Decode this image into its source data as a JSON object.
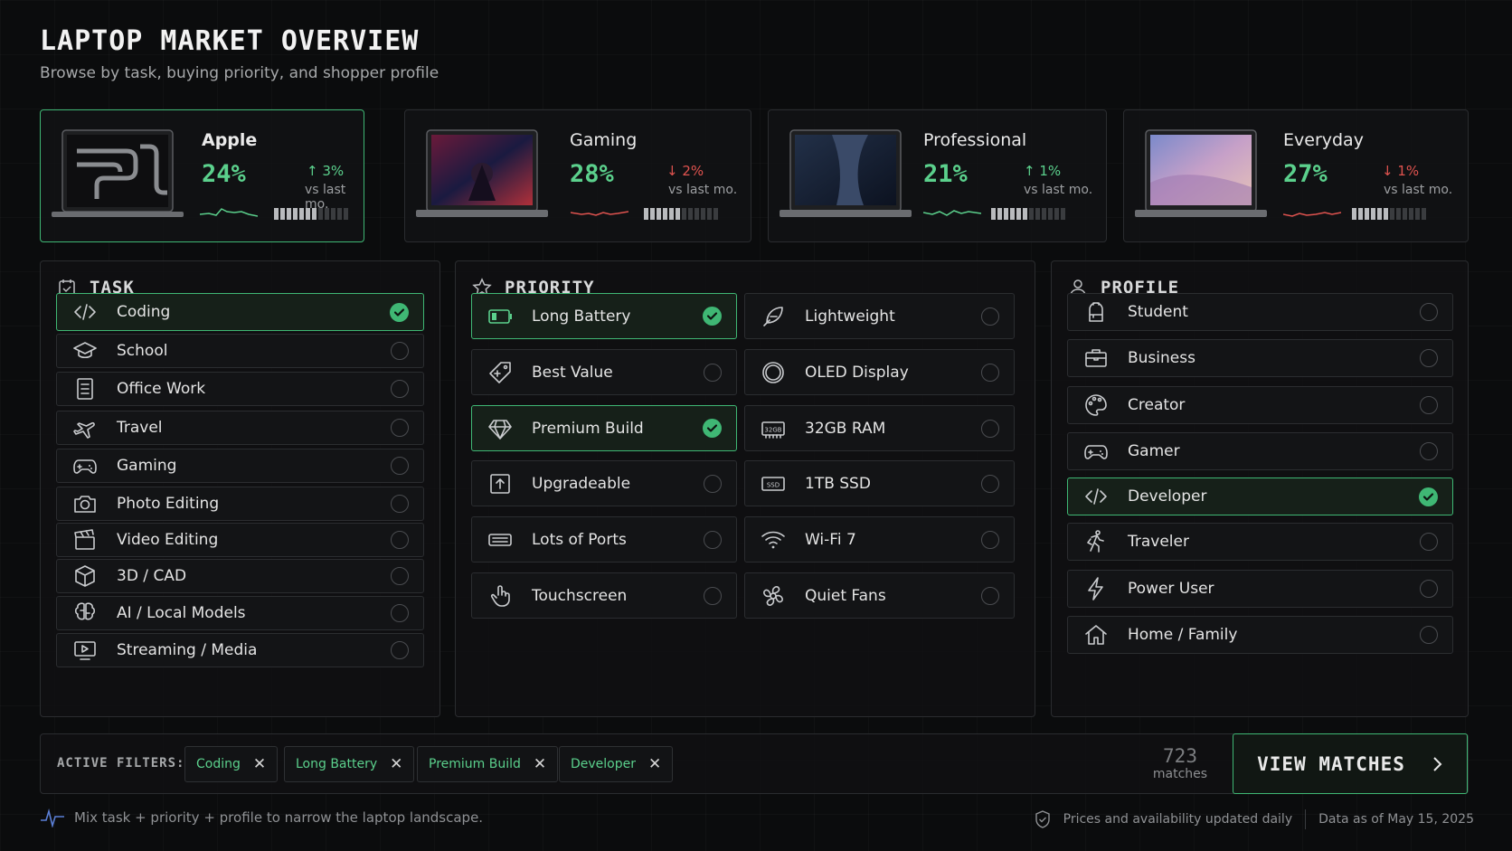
{
  "header": {
    "title": "LAPTOP MARKET OVERVIEW",
    "subtitle": "Browse by task, buying priority, and shopper profile"
  },
  "cards": [
    {
      "name": "Apple",
      "pct": "24%",
      "delta": "3%",
      "direction": "up",
      "vs": "vs last mo.",
      "bars_on": 7,
      "bars_total": 12,
      "selected": true
    },
    {
      "name": "Gaming",
      "pct": "28%",
      "delta": "2%",
      "direction": "down",
      "vs": "vs last mo.",
      "bars_on": 6,
      "bars_total": 12,
      "selected": false
    },
    {
      "name": "Professional",
      "pct": "21%",
      "delta": "1%",
      "direction": "up",
      "vs": "vs last mo.",
      "bars_on": 6,
      "bars_total": 12,
      "selected": false
    },
    {
      "name": "Everyday",
      "pct": "27%",
      "delta": "1%",
      "direction": "down",
      "vs": "vs last mo.",
      "bars_on": 6,
      "bars_total": 12,
      "selected": false
    }
  ],
  "task": {
    "heading": "TASK",
    "items": [
      {
        "label": "Coding",
        "icon": "code-icon",
        "selected": true
      },
      {
        "label": "School",
        "icon": "graduation-cap-icon",
        "selected": false
      },
      {
        "label": "Office Work",
        "icon": "document-icon",
        "selected": false
      },
      {
        "label": "Travel",
        "icon": "airplane-icon",
        "selected": false
      },
      {
        "label": "Gaming",
        "icon": "gamepad-icon",
        "selected": false
      },
      {
        "label": "Photo Editing",
        "icon": "camera-icon",
        "selected": false
      },
      {
        "label": "Video Editing",
        "icon": "clapperboard-icon",
        "selected": false
      },
      {
        "label": "3D / CAD",
        "icon": "cube-icon",
        "selected": false
      },
      {
        "label": "AI / Local Models",
        "icon": "brain-icon",
        "selected": false
      },
      {
        "label": "Streaming / Media",
        "icon": "monitor-play-icon",
        "selected": false
      }
    ]
  },
  "priority": {
    "heading": "PRIORITY",
    "left": [
      {
        "label": "Long Battery",
        "icon": "battery-icon",
        "selected": true
      },
      {
        "label": "Best Value",
        "icon": "price-tag-icon",
        "selected": false
      },
      {
        "label": "Premium Build",
        "icon": "diamond-icon",
        "selected": true
      },
      {
        "label": "Upgradeable",
        "icon": "upgrade-icon",
        "selected": false
      },
      {
        "label": "Lots of Ports",
        "icon": "ports-icon",
        "selected": false
      },
      {
        "label": "Touchscreen",
        "icon": "touch-icon",
        "selected": false
      }
    ],
    "right": [
      {
        "label": "Lightweight",
        "icon": "feather-icon",
        "selected": false
      },
      {
        "label": "OLED Display",
        "icon": "oled-icon",
        "selected": false
      },
      {
        "label": "32GB RAM",
        "icon": "ram-icon",
        "selected": false,
        "icon_text": "32GB"
      },
      {
        "label": "1TB SSD",
        "icon": "ssd-icon",
        "selected": false,
        "icon_text": "SSD"
      },
      {
        "label": "Wi-Fi 7",
        "icon": "wifi-icon",
        "selected": false
      },
      {
        "label": "Quiet Fans",
        "icon": "fan-icon",
        "selected": false
      }
    ]
  },
  "profile": {
    "heading": "PROFILE",
    "items": [
      {
        "label": "Student",
        "icon": "backpack-icon",
        "selected": false
      },
      {
        "label": "Business",
        "icon": "briefcase-icon",
        "selected": false
      },
      {
        "label": "Creator",
        "icon": "palette-icon",
        "selected": false
      },
      {
        "label": "Gamer",
        "icon": "gamepad-icon",
        "selected": false
      },
      {
        "label": "Developer",
        "icon": "code-icon",
        "selected": true
      },
      {
        "label": "Traveler",
        "icon": "traveler-icon",
        "selected": false
      },
      {
        "label": "Power User",
        "icon": "lightning-icon",
        "selected": false
      },
      {
        "label": "Home / Family",
        "icon": "home-icon",
        "selected": false
      }
    ]
  },
  "filters": {
    "label": "ACTIVE FILTERS:",
    "chips": [
      "Coding",
      "Long Battery",
      "Premium Build",
      "Developer"
    ],
    "remove_glyph": "✕",
    "count": "723",
    "count_label": "matches",
    "button_label": "VIEW MATCHES"
  },
  "footer": {
    "hint": "Mix task + priority + profile to narrow the laptop landscape.",
    "note": "Prices and availability updated daily",
    "date": "Data as of May 15, 2025"
  },
  "colors": {
    "accent": "#3fb774",
    "up": "#5bd08c",
    "down": "#e0534f",
    "background": "#0b0c0d"
  }
}
